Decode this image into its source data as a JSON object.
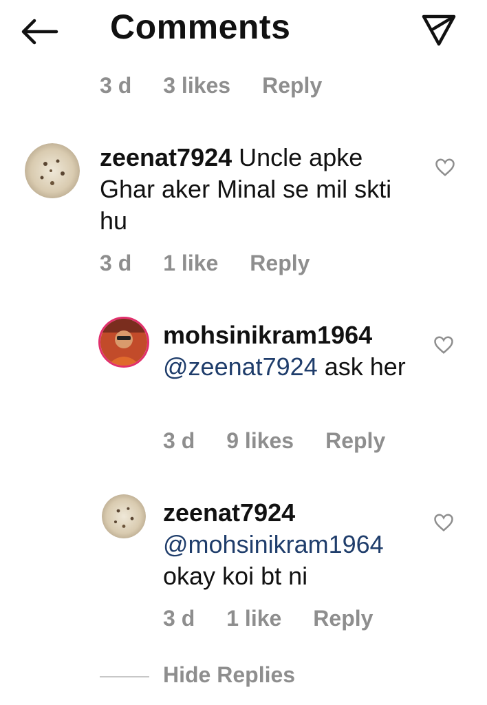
{
  "header": {
    "title": "Comments",
    "back_icon": "arrow-left-icon",
    "send_icon": "paper-plane-icon"
  },
  "top_meta": {
    "time": "3 d",
    "likes": "3 likes",
    "reply": "Reply"
  },
  "comments": [
    {
      "username": "zeenat7924",
      "text": " Uncle apke Ghar aker Minal se mil skti hu",
      "time": "3 d",
      "likes": "1 like",
      "reply": "Reply"
    },
    {
      "username": "mohsinikram1964",
      "mention": "@zeenat7924",
      "text": " ask her",
      "time": "3 d",
      "likes": "9 likes",
      "reply": "Reply"
    },
    {
      "username": "zeenat7924",
      "mention": "@mohsinikram1964",
      "text": "okay koi bt ni",
      "time": "3 d",
      "likes": "1 like",
      "reply": "Reply"
    }
  ],
  "hide_replies": "Hide Replies",
  "colors": {
    "muted": "#8e8e8e",
    "mention": "#1f3d6b",
    "text": "#111111"
  }
}
